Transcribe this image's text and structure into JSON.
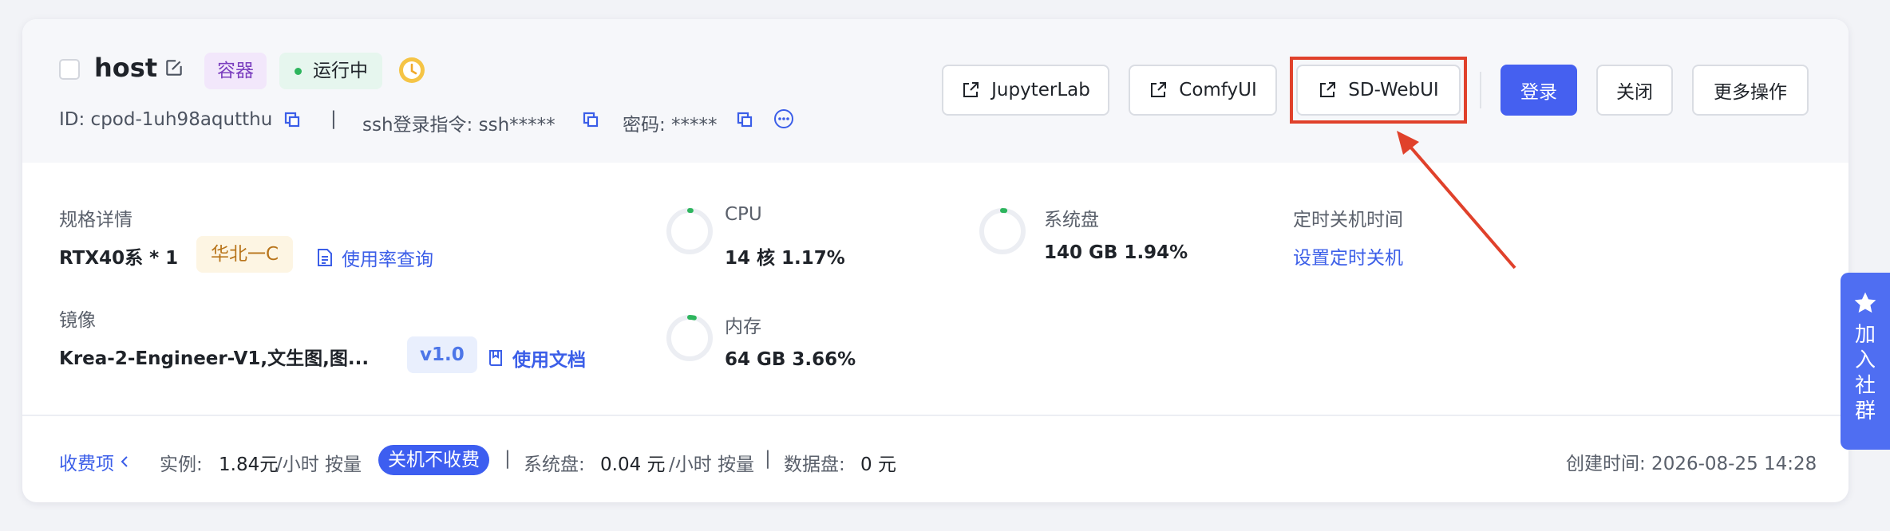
{
  "instance": {
    "name": "host",
    "type_tag": "容器",
    "status": "运行中",
    "id_text": "ID: cpod-1uh98aqutthu",
    "divider": "|",
    "ssh_text": "ssh登录指令: ssh*****",
    "password_text": "密码: *****"
  },
  "actions": {
    "jupyter": "JupyterLab",
    "comfy": "ComfyUI",
    "sdwebui": "SD-WebUI",
    "login": "登录",
    "close": "关闭",
    "more": "更多操作"
  },
  "specs": {
    "spec_label": "规格详情",
    "spec_value": "RTX40系 * 1",
    "region": "华北一C",
    "usage_link": "使用率查询",
    "image_label": "镜像",
    "image_value": "Krea-2-Engineer-V1,文生图,图...",
    "image_version": "v1.0",
    "docs_link": "使用文档"
  },
  "metrics": {
    "cpu_label": "CPU",
    "cpu_value": "14 核 1.17%",
    "cpu_usage": 1.17,
    "mem_label": "内存",
    "mem_value": "64 GB 3.66%",
    "mem_usage": 3.66,
    "disk_label": "系统盘",
    "disk_value": "140 GB 1.94%",
    "disk_usage": 1.94,
    "schedule_label": "定时关机时间",
    "schedule_link": "设置定时关机"
  },
  "billing": {
    "toggle": "收费项",
    "instance_label": "实例:",
    "instance_price": "1.84元",
    "instance_unit": "/小时 按量",
    "shutdown_pill": "关机不收费",
    "sep": "|",
    "disk_label": "系统盘:",
    "disk_price": "0.04 元",
    "disk_unit": "/小时 按量",
    "data_label": "数据盘:",
    "data_price": "0 元",
    "created": "创建时间: 2026-08-25 14:28"
  },
  "side": {
    "join_label": "加入社群"
  },
  "colors": {
    "primary": "#4560f0",
    "link": "#3b5ee8",
    "running": "#2db55d",
    "annotation": "#e0412b"
  },
  "icons": {
    "edit": "edit-icon",
    "clock": "clock-icon",
    "copy": "copy-icon",
    "more": "more-icon",
    "external": "external-link-icon",
    "doc": "document-icon",
    "book": "book-icon",
    "star": "star-icon",
    "chevron": "chevron-left-icon",
    "arrow": "annotation-arrow"
  }
}
